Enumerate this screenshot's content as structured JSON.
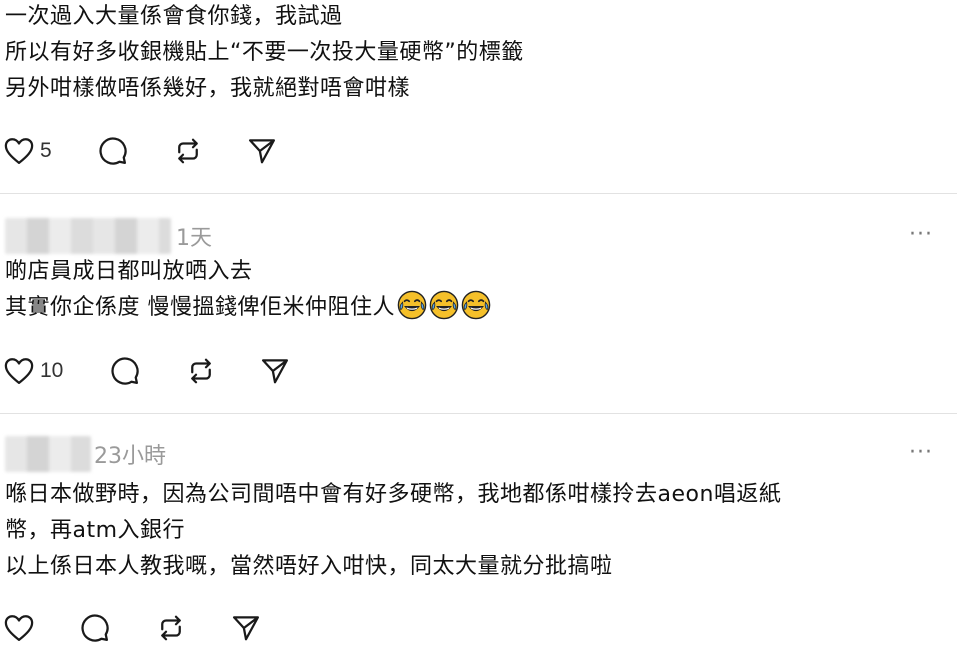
{
  "posts": [
    {
      "author_blurred": true,
      "time": "",
      "lines": [
        "一次過入大量係會食你錢，我試過",
        "所以有好多收銀機貼上“不要一次投大量硬幣”的標籤",
        "另外咁樣做唔係幾好，我就絕對唔會咁樣"
      ],
      "likes": "5"
    },
    {
      "author_blurred": true,
      "time": "1天",
      "more_label": "···",
      "lines": [
        "啲店員成日都叫放哂入去",
        "其實你企係度 慢慢搵錢俾佢米仲阻住人"
      ],
      "emoji": [
        "face-with-tears-of-joy",
        "face-with-tears-of-joy",
        "face-with-tears-of-joy"
      ],
      "likes": "10"
    },
    {
      "author_blurred": true,
      "time": "23小時",
      "more_label": "···",
      "lines": [
        "喺日本做野時，因為公司間唔中會有好多硬幣，我地都係咁樣拎去aeon唱返紙",
        "幣，再atm入銀行",
        "以上係日本人教我嘅，當然唔好入咁快，同太大量就分批搞啦"
      ],
      "likes": ""
    }
  ],
  "icons": {
    "like": "heart-icon",
    "reply": "comment-icon",
    "repost": "repost-icon",
    "share": "send-icon"
  },
  "colors": {
    "text": "#111111",
    "muted": "#9a9a9a",
    "icon": "#1a1a1a",
    "divider": "#e2e2e2"
  }
}
